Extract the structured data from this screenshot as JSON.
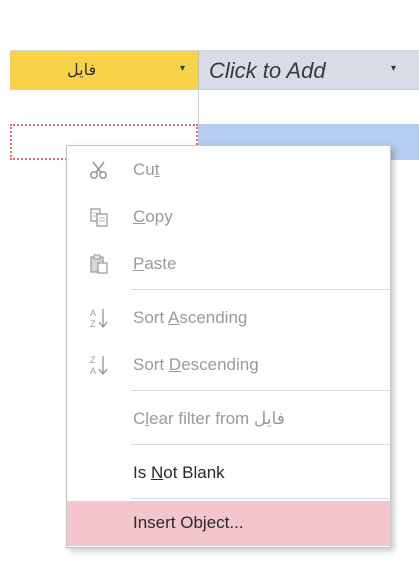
{
  "table": {
    "field_column": {
      "label": "فایل",
      "dropdown_icon": "dropdown-arrow-icon"
    },
    "add_column": {
      "label": "Click to Add",
      "dropdown_icon": "dropdown-arrow-icon"
    }
  },
  "context_menu": {
    "items": [
      {
        "id": "cut",
        "label": "Cut",
        "icon": "scissors-icon",
        "enabled": false
      },
      {
        "id": "copy",
        "label": "Copy",
        "icon": "copy-icon",
        "enabled": false
      },
      {
        "id": "paste",
        "label": "Paste",
        "icon": "paste-icon",
        "enabled": false
      },
      {
        "id": "sort_asc",
        "label": "Sort Ascending",
        "icon": "sort-ascending-icon",
        "enabled": false
      },
      {
        "id": "sort_desc",
        "label": "Sort Descending",
        "icon": "sort-descending-icon",
        "enabled": false
      },
      {
        "id": "clear_filter",
        "label": "Clear filter from فایل",
        "icon": "",
        "enabled": false
      },
      {
        "id": "is_not_blank",
        "label": "Is Not Blank",
        "icon": "",
        "enabled": true
      },
      {
        "id": "insert_object",
        "label": "Insert Object...",
        "icon": "",
        "enabled": true,
        "hovered": true
      }
    ]
  },
  "colors": {
    "field_header_bg": "#f9d347",
    "add_header_bg": "#d7dce7",
    "selected_row_bg": "#b4cdf0",
    "hover_bg": "#f3c5cc"
  }
}
